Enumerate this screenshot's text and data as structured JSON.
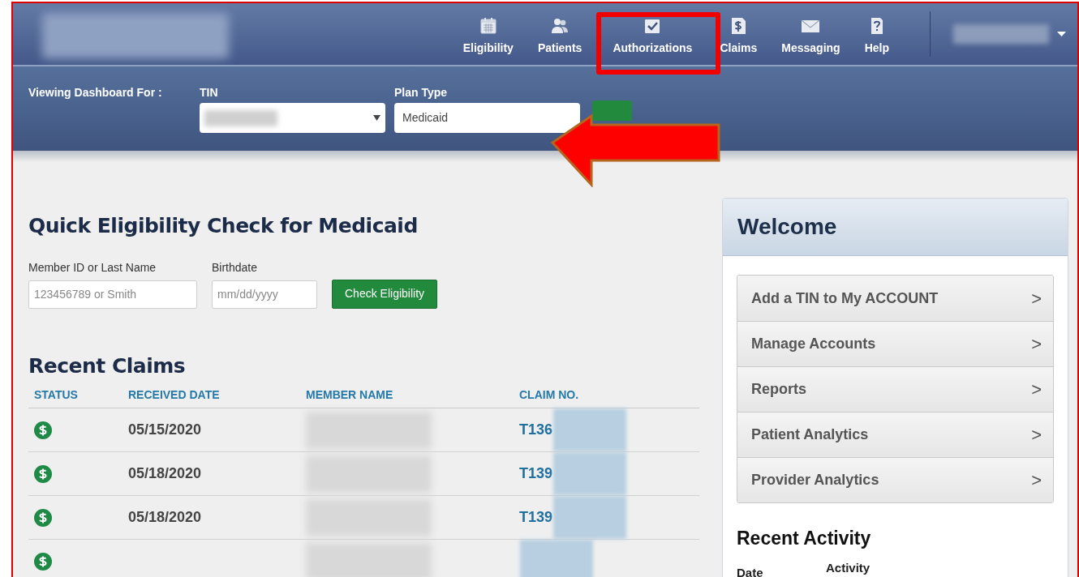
{
  "header": {
    "nav_items": [
      {
        "label": "Eligibility",
        "highlighted": false
      },
      {
        "label": "Patients",
        "highlighted": false
      },
      {
        "label": "Authorizations",
        "highlighted": true
      },
      {
        "label": "Claims",
        "highlighted": false
      },
      {
        "label": "Messaging",
        "highlighted": false
      },
      {
        "label": "Help",
        "highlighted": false
      }
    ]
  },
  "filter_bar": {
    "label": "Viewing Dashboard For :",
    "tin": {
      "label": "TIN"
    },
    "plan_type": {
      "label": "Plan Type",
      "value": "Medicaid"
    }
  },
  "quick_check": {
    "title": "Quick Eligibility Check for Medicaid",
    "fields": [
      {
        "label": "Member ID or Last Name",
        "placeholder": "123456789 or Smith"
      },
      {
        "label": "Birthdate",
        "placeholder": "mm/dd/yyyy"
      }
    ],
    "button": "Check Eligibility"
  },
  "recent_claims": {
    "title": "Recent Claims",
    "columns": [
      "STATUS",
      "RECEIVED DATE",
      "MEMBER NAME",
      "CLAIM NO."
    ],
    "rows": [
      {
        "received_date": "05/15/2020",
        "claim_no": "T136"
      },
      {
        "received_date": "05/18/2020",
        "claim_no": "T139"
      },
      {
        "received_date": "05/18/2020",
        "claim_no": "T139"
      },
      {}
    ]
  },
  "welcome": {
    "title": "Welcome",
    "links": [
      "Add a TIN to My ACCOUNT",
      "Manage Accounts",
      "Reports",
      "Patient Analytics",
      "Provider Analytics"
    ],
    "link_arrow": ">",
    "recent_activity": {
      "title": "Recent Activity",
      "columns": [
        "Date",
        "Activity"
      ]
    }
  }
}
